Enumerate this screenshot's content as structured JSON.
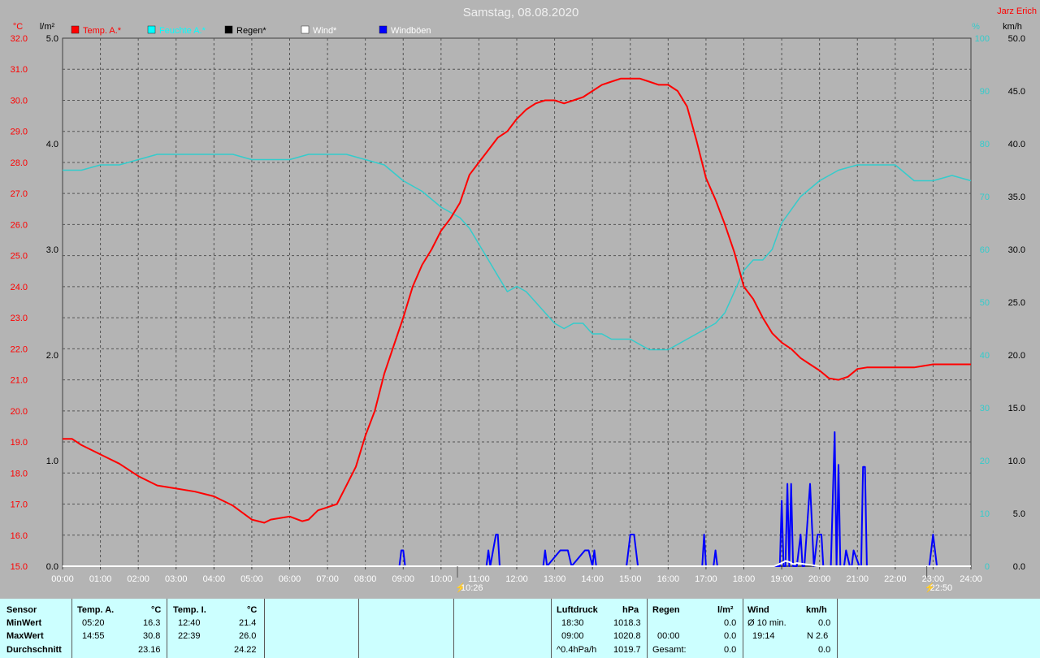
{
  "title": "Samstag, 08.08.2020",
  "author": "Jarz Erich",
  "units": {
    "temp": "°C",
    "rain": "l/m²",
    "hum": "%",
    "wind": "km/h"
  },
  "colors": {
    "temp": "#ff0000",
    "hum": "#33cccc",
    "rain": "#000000",
    "wind": "#ffffff",
    "gust": "#0000ff",
    "bg": "#b4b4b4",
    "grid": "#555555",
    "stats_bg": "#ccffff"
  },
  "legend": [
    {
      "label": "Temp. A.*",
      "color": "#ff0000",
      "text_color": "#ff0000"
    },
    {
      "label": "Feuchte A.*",
      "color": "#00ffff",
      "text_color": "#00ffff"
    },
    {
      "label": "Regen*",
      "color": "#000000",
      "text_color": "#000000"
    },
    {
      "label": "Wind*",
      "color": "#ffffff",
      "text_color": "#ffffff"
    },
    {
      "label": "Windböen",
      "color": "#0000ff",
      "text_color": "#ffffff"
    }
  ],
  "markers": [
    {
      "label": "10:26"
    },
    {
      "label": "22:50"
    }
  ],
  "chart_data": {
    "type": "line",
    "x_label_ticks": [
      "00:00",
      "01:00",
      "02:00",
      "03:00",
      "04:00",
      "05:00",
      "06:00",
      "07:00",
      "08:00",
      "09:00",
      "10:00",
      "11:00",
      "12:00",
      "13:00",
      "14:00",
      "15:00",
      "16:00",
      "17:00",
      "18:00",
      "19:00",
      "20:00",
      "21:00",
      "22:00",
      "23:00",
      "24:00"
    ],
    "axes": {
      "temp": {
        "range": [
          15.0,
          32.0
        ],
        "ticks": [
          "32.0",
          "31.0",
          "30.0",
          "29.0",
          "28.0",
          "27.0",
          "26.0",
          "25.0",
          "24.0",
          "23.0",
          "22.0",
          "21.0",
          "20.0",
          "19.0",
          "18.0",
          "17.0",
          "16.0",
          "15.0"
        ]
      },
      "rain": {
        "range": [
          0.0,
          5.0
        ],
        "ticks": [
          "5.0",
          "4.0",
          "3.0",
          "2.0",
          "1.0",
          "0.0"
        ]
      },
      "hum": {
        "range": [
          0,
          100
        ],
        "ticks": [
          "100",
          "90",
          "80",
          "70",
          "60",
          "50",
          "40",
          "30",
          "20",
          "10",
          "0"
        ]
      },
      "wind": {
        "range": [
          0.0,
          50.0
        ],
        "ticks": [
          "50.0",
          "45.0",
          "40.0",
          "35.0",
          "30.0",
          "25.0",
          "20.0",
          "15.0",
          "10.0",
          "5.0",
          "0.0"
        ]
      }
    },
    "series": [
      {
        "name": "Temp. A.*",
        "x_hours": [
          0,
          0.25,
          0.5,
          1,
          1.5,
          2,
          2.5,
          3,
          3.5,
          4,
          4.5,
          5,
          5.33,
          5.5,
          6,
          6.33,
          6.5,
          6.75,
          7,
          7.25,
          7.5,
          7.75,
          8,
          8.25,
          8.5,
          8.75,
          9,
          9.25,
          9.5,
          9.75,
          10,
          10.25,
          10.5,
          10.75,
          11,
          11.25,
          11.5,
          11.75,
          12,
          12.25,
          12.5,
          12.75,
          13,
          13.25,
          13.5,
          13.75,
          14,
          14.25,
          14.5,
          14.75,
          15,
          15.25,
          15.5,
          15.75,
          16,
          16.25,
          16.5,
          16.75,
          17,
          17.25,
          17.5,
          17.75,
          18,
          18.25,
          18.5,
          18.75,
          19,
          19.25,
          19.5,
          19.75,
          20,
          20.25,
          20.5,
          20.75,
          21,
          21.25,
          21.5,
          21.75,
          22,
          22.25,
          22.5,
          22.75,
          23,
          23.25,
          23.5,
          23.75,
          24
        ],
        "values": [
          19.1,
          19.1,
          18.9,
          18.6,
          18.3,
          17.9,
          17.6,
          17.5,
          17.4,
          17.25,
          16.95,
          16.5,
          16.4,
          16.5,
          16.6,
          16.45,
          16.5,
          16.8,
          16.9,
          17.0,
          17.6,
          18.2,
          19.2,
          20.0,
          21.2,
          22.1,
          23.0,
          24.0,
          24.7,
          25.2,
          25.8,
          26.2,
          26.7,
          27.6,
          28.0,
          28.4,
          28.8,
          29.0,
          29.4,
          29.7,
          29.9,
          30.0,
          30.0,
          29.9,
          30.0,
          30.1,
          30.3,
          30.5,
          30.6,
          30.7,
          30.7,
          30.7,
          30.6,
          30.5,
          30.5,
          30.3,
          29.8,
          28.7,
          27.5,
          26.8,
          26.0,
          25.1,
          24.0,
          23.6,
          23.0,
          22.5,
          22.2,
          22.0,
          21.7,
          21.5,
          21.3,
          21.05,
          21.0,
          21.1,
          21.35,
          21.4,
          21.4,
          21.4,
          21.4,
          21.4,
          21.4,
          21.45,
          21.5,
          21.5,
          21.5,
          21.5,
          21.5
        ]
      },
      {
        "name": "Feuchte A.*",
        "x_hours": [
          0,
          0.5,
          1,
          1.5,
          2,
          2.5,
          3,
          3.5,
          4,
          4.5,
          5,
          5.5,
          6,
          6.5,
          7,
          7.5,
          8,
          8.5,
          9,
          9.5,
          10,
          10.25,
          10.5,
          10.75,
          11,
          11.25,
          11.5,
          11.75,
          12,
          12.25,
          12.5,
          12.75,
          13,
          13.25,
          13.5,
          13.75,
          14,
          14.25,
          14.5,
          14.75,
          15,
          15.25,
          15.5,
          15.75,
          16,
          16.25,
          16.5,
          16.75,
          17,
          17.25,
          17.5,
          17.75,
          18,
          18.25,
          18.5,
          18.75,
          19,
          19.5,
          20,
          20.5,
          21,
          21.5,
          22,
          22.5,
          23,
          23.5,
          24
        ],
        "values": [
          75,
          75,
          76,
          76,
          77,
          78,
          78,
          78,
          78,
          78,
          77,
          77,
          77,
          78,
          78,
          78,
          77,
          76,
          73,
          71,
          68,
          67,
          66,
          64,
          61,
          58,
          55,
          52,
          53,
          52,
          50,
          48,
          46,
          45,
          46,
          46,
          44,
          44,
          43,
          43,
          43,
          42,
          41,
          41,
          41,
          42,
          43,
          44,
          45,
          46,
          48,
          52,
          56,
          58,
          58,
          60,
          65,
          70,
          73,
          75,
          76,
          76,
          76,
          73,
          73,
          74,
          73
        ]
      },
      {
        "name": "Windböen",
        "x_hours": [
          0,
          8.9,
          8.95,
          9.0,
          9.05,
          11.2,
          11.25,
          11.3,
          11.45,
          11.5,
          11.55,
          12.7,
          12.75,
          12.8,
          13.15,
          13.25,
          13.35,
          13.45,
          13.8,
          13.9,
          14.0,
          14.05,
          14.1,
          14.2,
          14.9,
          15.0,
          15.1,
          15.2,
          16.9,
          16.95,
          17.0,
          17.2,
          17.25,
          17.3,
          18.95,
          19.0,
          19.05,
          19.1,
          19.15,
          19.2,
          19.25,
          19.3,
          19.35,
          19.4,
          19.5,
          19.55,
          19.6,
          19.75,
          19.85,
          19.95,
          20.05,
          20.1,
          20.2,
          20.3,
          20.4,
          20.45,
          20.5,
          20.55,
          20.6,
          20.65,
          20.7,
          20.8,
          20.85,
          20.9,
          21.05,
          21.1,
          21.15,
          21.2,
          21.25,
          21.3,
          21.35,
          21.4,
          22.9,
          23.0,
          23.1,
          24
        ],
        "values": [
          0,
          0,
          1.5,
          1.5,
          0,
          0,
          1.5,
          0,
          3.0,
          3.0,
          0,
          0,
          1.5,
          0,
          1.5,
          1.5,
          1.5,
          0,
          1.5,
          1.5,
          0,
          1.5,
          0,
          0,
          0,
          3.0,
          3.0,
          0,
          0,
          3.0,
          0,
          0,
          1.5,
          0,
          0,
          6.2,
          0,
          0,
          7.8,
          0,
          7.8,
          0,
          0,
          0,
          3.0,
          0,
          0,
          7.8,
          0,
          3.0,
          3.0,
          0,
          0,
          0,
          12.7,
          0,
          9.6,
          0,
          0,
          0,
          1.5,
          0,
          0,
          1.5,
          0,
          0,
          9.4,
          9.4,
          0,
          0,
          0,
          0,
          0,
          3.0,
          0,
          0
        ]
      },
      {
        "name": "Wind*",
        "x_hours": [
          0,
          18.8,
          19.0,
          19.1,
          19.2,
          19.3,
          19.4,
          19.6,
          19.8,
          20.0,
          24
        ],
        "values": [
          0,
          0,
          0.3,
          0.5,
          0.4,
          0.2,
          0.3,
          0.2,
          0.1,
          0,
          0
        ]
      },
      {
        "name": "Regen*",
        "x_hours": [
          0,
          24
        ],
        "values": [
          0,
          0
        ]
      }
    ]
  },
  "stats": {
    "columns": {
      "sensor": {
        "header": "Sensor",
        "rows": [
          "MinWert",
          "MaxWert",
          "Durchschnitt"
        ]
      },
      "temp_a": {
        "header": "Temp. A.",
        "unit": "°C",
        "min_time": "05:20",
        "min_val": "16.3",
        "max_time": "14:55",
        "max_val": "30.8",
        "avg": "23.16"
      },
      "temp_i": {
        "header": "Temp. I.",
        "unit": "°C",
        "min_time": "12:40",
        "min_val": "21.4",
        "max_time": "22:39",
        "max_val": "26.0",
        "avg": "24.22"
      },
      "pressure": {
        "header": "Luftdruck",
        "unit": "hPa",
        "min_time": "18:30",
        "min_val": "1018.3",
        "max_time": "09:00",
        "max_val": "1020.8",
        "trend_label": "^0.4hPa/h",
        "trend_val": "1019.7"
      },
      "rain": {
        "header": "Regen",
        "unit": "l/m²",
        "row2_time": "00:00",
        "row2_val": "0.0",
        "row3_label": "Gesamt:",
        "row3_val": "0.0",
        "row1_val": "0.0"
      },
      "wind": {
        "header": "Wind",
        "unit": "km/h",
        "row1_label": "Ø 10 min.",
        "row1_val": "0.0",
        "row2_time": "19:14",
        "row2_val": "N 2.6",
        "row3_val": "0.0"
      }
    }
  }
}
